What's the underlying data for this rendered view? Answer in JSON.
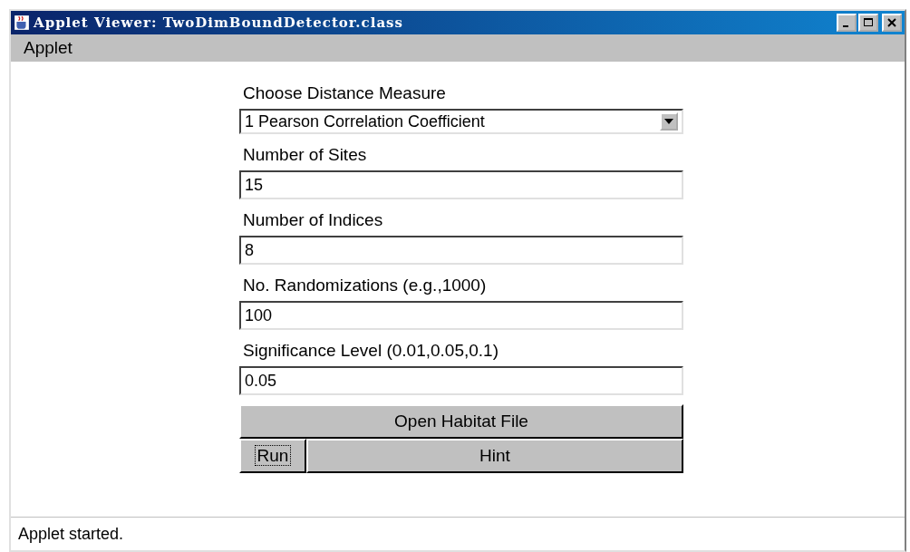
{
  "window": {
    "title": "Applet Viewer: TwoDimBoundDetector.class"
  },
  "menu": [
    "Applet"
  ],
  "form": {
    "measure": {
      "label": "Choose Distance Measure",
      "value": "1 Pearson Correlation Coefficient"
    },
    "fields": [
      {
        "label": "Number of Sites",
        "value": "15"
      },
      {
        "label": "Number of Indices",
        "value": "8"
      },
      {
        "label": "No. Randomizations (e.g.,1000)",
        "value": "100"
      },
      {
        "label": "Significance Level (0.01,0.05,0.1)",
        "value": "0.05"
      }
    ],
    "open_button": {
      "label": "Open Habitat File",
      "focused": false
    },
    "run_button": {
      "label": "Run",
      "focused": true
    },
    "hint_button": {
      "label": "Hint",
      "focused": false
    }
  },
  "status_bar": "Applet started."
}
